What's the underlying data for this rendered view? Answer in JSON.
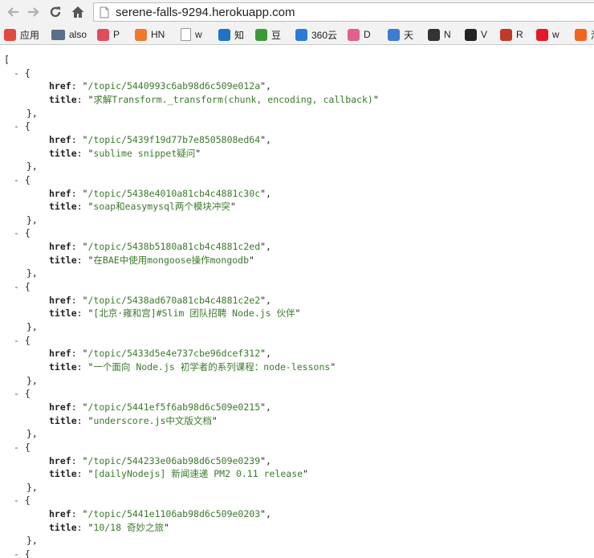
{
  "browser": {
    "url": "serene-falls-9294.herokuapp.com",
    "bookmarks": [
      {
        "label": "应用",
        "icon": "apps-grid-icon",
        "color": "#e04a3f"
      },
      {
        "label": "also",
        "icon": "folder-icon",
        "color": "#5b6e8a"
      },
      {
        "label": "P",
        "icon": "pocket-icon",
        "color": "#e44b5a"
      },
      {
        "label": "HN",
        "icon": "hacker-news-icon",
        "color": "#f0782b"
      },
      {
        "label": "w",
        "icon": "page-icon",
        "color": "#ffffff"
      },
      {
        "label": "知",
        "icon": "zhihu-icon",
        "color": "#1e73c8"
      },
      {
        "label": "豆",
        "icon": "douban-icon",
        "color": "#3a9a3a"
      },
      {
        "label": "360云",
        "icon": "cloud-icon",
        "color": "#2b7bd6"
      },
      {
        "label": "D",
        "icon": "dribbble-icon",
        "color": "#e45f8e"
      },
      {
        "label": "天",
        "icon": "globe-icon",
        "color": "#3c7bd0"
      },
      {
        "label": "N",
        "icon": "node-icon",
        "color": "#333333"
      },
      {
        "label": "V",
        "icon": "v2ex-icon",
        "color": "#222222"
      },
      {
        "label": "R",
        "icon": "red-dot-icon",
        "color": "#c0392b"
      },
      {
        "label": "w",
        "icon": "weibo-icon",
        "color": "#e6162d"
      },
      {
        "label": "淘",
        "icon": "taobao-icon",
        "color": "#f4621f"
      }
    ]
  },
  "json": {
    "open_bracket": "[",
    "collapse_marker": "-",
    "open_brace": "{",
    "close_brace": "},",
    "key_href": "href",
    "key_title": "title",
    "items": [
      {
        "href": "/topic/5440993c6ab98d6c509e012a",
        "title": "求解Transform._transform(chunk, encoding, callback)"
      },
      {
        "href": "/topic/5439f19d77b7e8505808ed64",
        "title": "sublime snippet疑问"
      },
      {
        "href": "/topic/5438e4010a81cb4c4881c30c",
        "title": "soap和easymysql两个模块冲突"
      },
      {
        "href": "/topic/5438b5180a81cb4c4881c2ed",
        "title": "在BAE中使用mongoose操作mongodb"
      },
      {
        "href": "/topic/5438ad670a81cb4c4881c2e2",
        "title": "[北京·雍和宫]#Slim 团队招聘 Node.js 伙伴"
      },
      {
        "href": "/topic/5433d5e4e737cbe96dcef312",
        "title": "一个面向 Node.js 初学者的系列课程：node-lessons"
      },
      {
        "href": "/topic/5441ef5f6ab98d6c509e0215",
        "title": "underscore.js中文版文档"
      },
      {
        "href": "/topic/544233e06ab98d6c509e0239",
        "title": "[dailyNodejs] 新闻速递 PM2 0.11 release"
      },
      {
        "href": "/topic/5441e1106ab98d6c509e0203",
        "title": "10/18 奇妙之旅"
      }
    ]
  }
}
